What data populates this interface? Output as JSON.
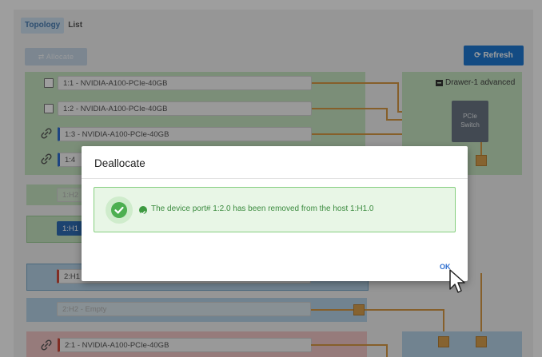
{
  "tabs": [
    {
      "label": "Topology",
      "active": true
    },
    {
      "label": "List",
      "active": false
    }
  ],
  "toolbar": {
    "allocate_label": "⇄ Allocate",
    "refresh_label": "⟳ Refresh"
  },
  "drawer": {
    "label": "Drawer-1 advanced",
    "switch_label_1": "PCIe",
    "switch_label_2": "Switch"
  },
  "devices": {
    "d1": "1:1 - NVIDIA-A100-PCIe-40GB",
    "d2": "1:2 - NVIDIA-A100-PCIe-40GB",
    "d3": "1:3 - NVIDIA-A100-PCIe-40GB",
    "d4": "1:4",
    "h2": "1:H2",
    "h1": "1:H1",
    "h2_1": "2:H1",
    "h2_2": "2:H2 - Empty",
    "d21": "2:1 - NVIDIA-A100-PCIe-40GB"
  },
  "modal": {
    "title": "Deallocate",
    "message": "The device port# 1:2.0 has been removed from the host 1:H1.0",
    "ok_label": "OK"
  },
  "colors": {
    "accent": "#1f7ad4",
    "success": "#4caf50",
    "cable": "#d99a45",
    "host_green": "#c7e6c2",
    "host_blue": "#b7d4e8"
  }
}
